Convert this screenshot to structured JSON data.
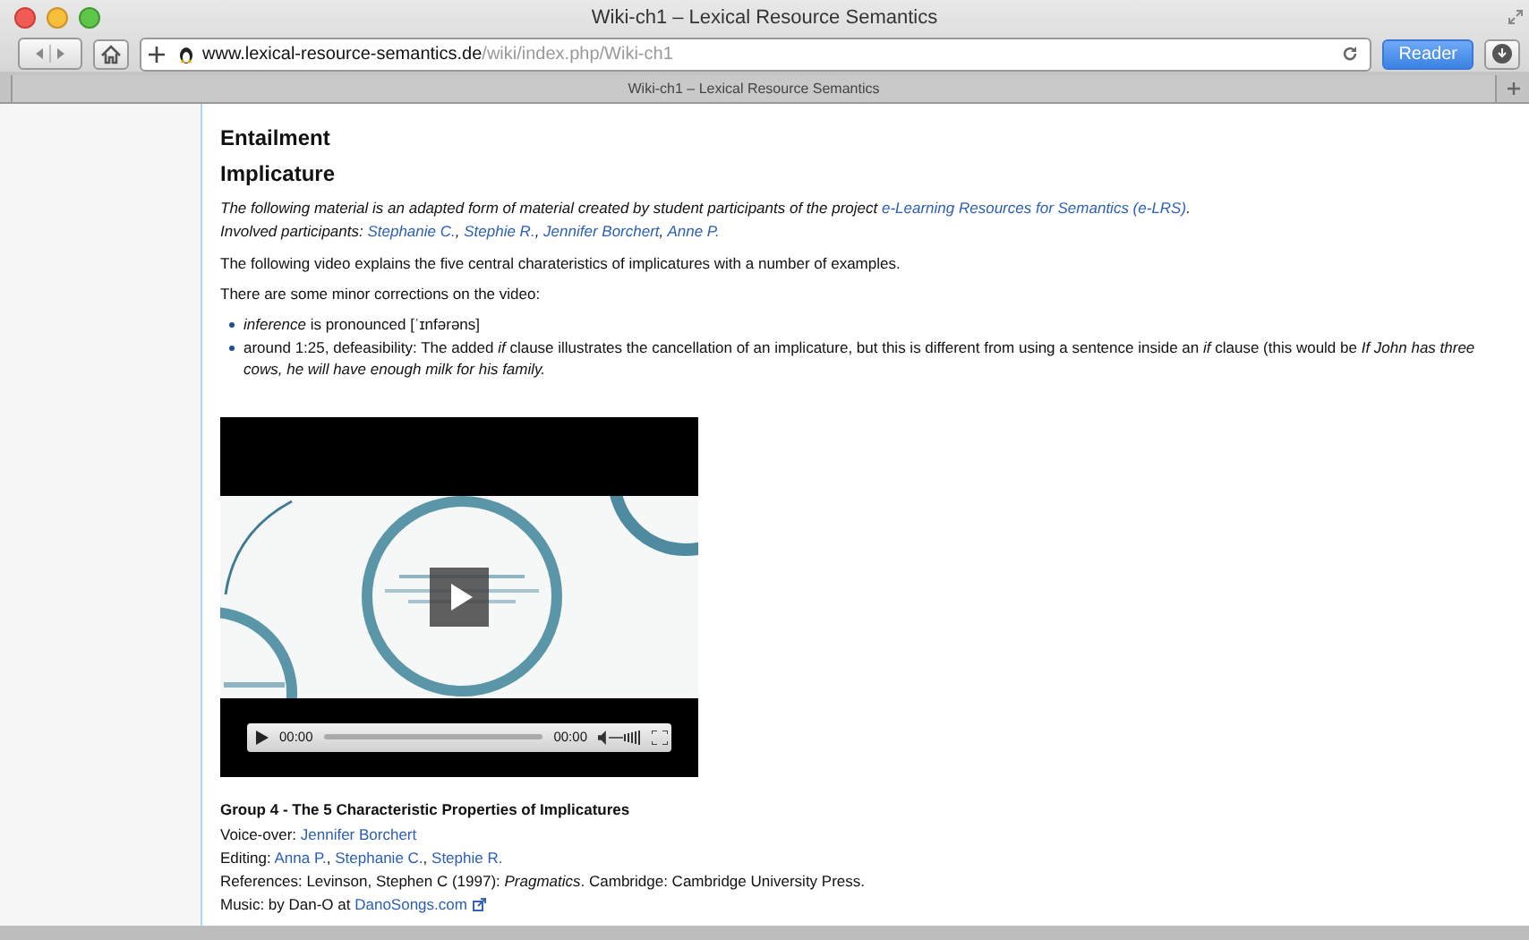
{
  "window": {
    "title": "Wiki-ch1 – Lexical Resource Semantics"
  },
  "toolbar": {
    "url_host": "www.lexical-resource-semantics.de",
    "url_path": "/wiki/index.php/Wiki-ch1",
    "reader_button": "Reader"
  },
  "tabs": [
    {
      "label": "Wiki-ch1 – Lexical Resource Semantics",
      "selected": true
    }
  ],
  "content": [
    {
      "kind": "heading",
      "parts": [
        {
          "kind": "text",
          "text": "Entailment"
        }
      ]
    },
    {
      "kind": "heading",
      "parts": [
        {
          "kind": "text",
          "text": "Implicature"
        }
      ]
    },
    {
      "kind": "note",
      "parts": [
        {
          "kind": "text",
          "text": "The following material is an adapted form of material created by student participants of the project "
        },
        {
          "kind": "link",
          "text": "e-Learning Resources for Semantics (e-LRS)"
        },
        {
          "kind": "text",
          "text": "."
        }
      ]
    },
    {
      "kind": "note",
      "parts": [
        {
          "kind": "text",
          "text": "Involved participants: "
        },
        {
          "kind": "link",
          "text": "Stephanie C."
        },
        {
          "kind": "text",
          "text": ", "
        },
        {
          "kind": "link",
          "text": "Stephie R."
        },
        {
          "kind": "text",
          "text": ", "
        },
        {
          "kind": "link",
          "text": "Jennifer Borchert"
        },
        {
          "kind": "text",
          "text": ", "
        },
        {
          "kind": "link",
          "text": "Anne P."
        }
      ]
    },
    {
      "kind": "paragraph",
      "parts": [
        {
          "kind": "text",
          "text": "The following video explains the five central charateristics of implicatures with a number of examples."
        }
      ]
    },
    {
      "kind": "paragraph",
      "parts": [
        {
          "kind": "text",
          "text": "There are some minor corrections on the video:"
        }
      ]
    },
    {
      "kind": "bullets",
      "items": [
        {
          "parts": [
            {
              "kind": "text",
              "text": "*inference* is pronounced [ˈɪnfərəns]"
            }
          ]
        },
        {
          "parts": [
            {
              "kind": "text",
              "text": "around 1:25, defeasibility: The added *if* clause illustrates the cancellation of an implicature, but this is different from using a sentence inside an *if* clause (this would be *If John has three cows, he will have enough milk for his family.*"
            }
          ]
        }
      ]
    },
    {
      "kind": "video",
      "current_time": "00:00",
      "duration": "00:00"
    },
    {
      "kind": "caption",
      "parts": [
        {
          "kind": "text",
          "text": "Group 4 - The 5 Characteristic Properties of Implicatures"
        }
      ]
    },
    {
      "kind": "line",
      "parts": [
        {
          "kind": "text",
          "text": "Voice-over: "
        },
        {
          "kind": "link",
          "text": "Jennifer Borchert"
        }
      ]
    },
    {
      "kind": "line",
      "parts": [
        {
          "kind": "text",
          "text": "Editing: "
        },
        {
          "kind": "link",
          "text": "Anna P."
        },
        {
          "kind": "text",
          "text": ", "
        },
        {
          "kind": "link",
          "text": "Stephanie C."
        },
        {
          "kind": "text",
          "text": ", "
        },
        {
          "kind": "link",
          "text": "Stephie R."
        }
      ]
    },
    {
      "kind": "line",
      "parts": [
        {
          "kind": "text",
          "text": "References: Levinson, Stephen C (1997): *Pragmatics*. Cambridge: Cambridge University Press."
        }
      ]
    },
    {
      "kind": "line",
      "parts": [
        {
          "kind": "text",
          "text": "Music: by Dan-O at "
        },
        {
          "kind": "extlink",
          "text": "DanoSongs.com"
        }
      ]
    }
  ]
}
